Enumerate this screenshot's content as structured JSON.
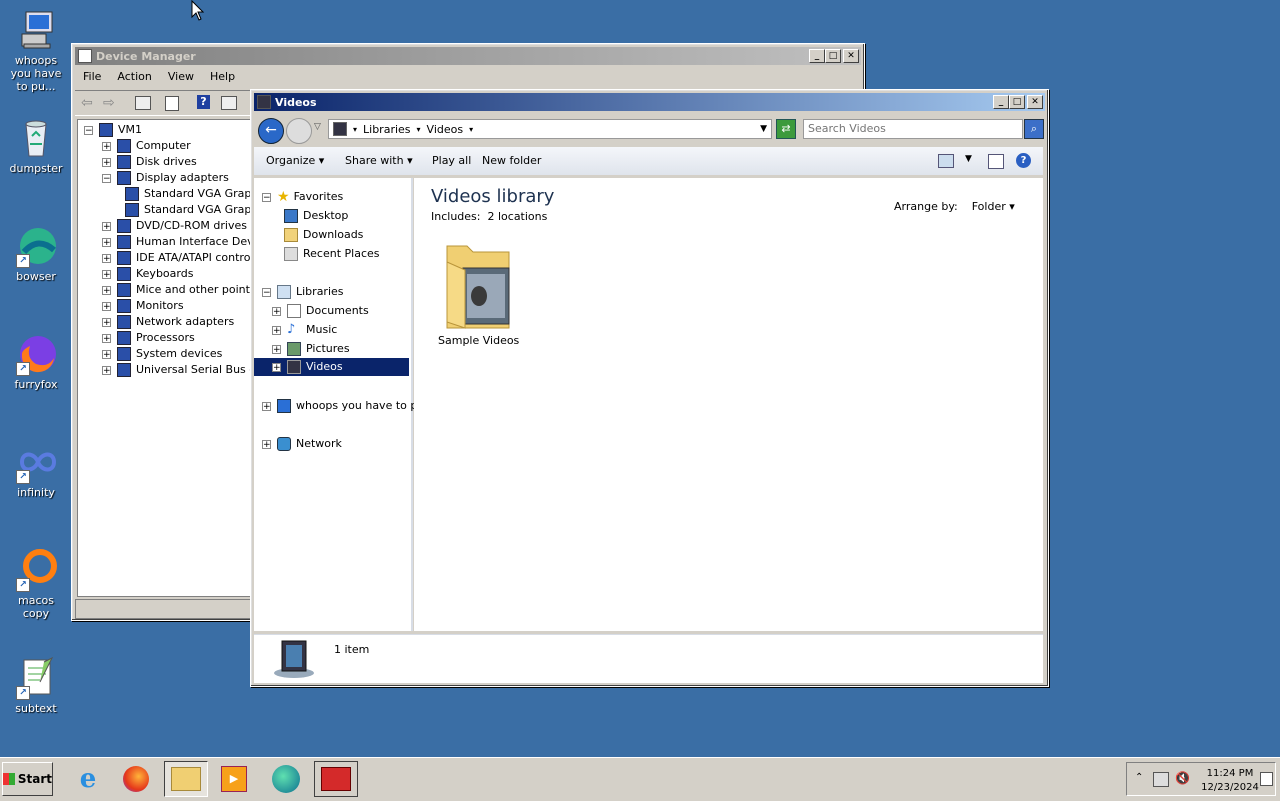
{
  "desktop": {
    "icons": [
      {
        "label": "whoops you have to pu...",
        "icon": "computer-icon"
      },
      {
        "label": "dumpster",
        "icon": "recycle-bin-icon"
      },
      {
        "label": "bowser",
        "icon": "edge-browser-icon"
      },
      {
        "label": "furryfox",
        "icon": "firefox-icon"
      },
      {
        "label": "infinity",
        "icon": "infinity-icon"
      },
      {
        "label": "macos copy",
        "icon": "ring-icon"
      },
      {
        "label": "subtext",
        "icon": "text-editor-icon"
      }
    ]
  },
  "device_manager": {
    "title": "Device Manager",
    "menu": [
      "File",
      "Action",
      "View",
      "Help"
    ],
    "tree": [
      {
        "label": "VM1",
        "level": 0,
        "expander": "-"
      },
      {
        "label": "Computer",
        "level": 1,
        "expander": "+"
      },
      {
        "label": "Disk drives",
        "level": 1,
        "expander": "+"
      },
      {
        "label": "Display adapters",
        "level": 1,
        "expander": "-"
      },
      {
        "label": "Standard VGA Grap",
        "level": 2,
        "expander": ""
      },
      {
        "label": "Standard VGA Grap",
        "level": 2,
        "expander": ""
      },
      {
        "label": "DVD/CD-ROM drives",
        "level": 1,
        "expander": "+"
      },
      {
        "label": "Human Interface Devic",
        "level": 1,
        "expander": "+"
      },
      {
        "label": "IDE ATA/ATAPI controll",
        "level": 1,
        "expander": "+"
      },
      {
        "label": "Keyboards",
        "level": 1,
        "expander": "+"
      },
      {
        "label": "Mice and other pointing",
        "level": 1,
        "expander": "+"
      },
      {
        "label": "Monitors",
        "level": 1,
        "expander": "+"
      },
      {
        "label": "Network adapters",
        "level": 1,
        "expander": "+"
      },
      {
        "label": "Processors",
        "level": 1,
        "expander": "+"
      },
      {
        "label": "System devices",
        "level": 1,
        "expander": "+"
      },
      {
        "label": "Universal Serial Bus cor",
        "level": 1,
        "expander": "+"
      }
    ]
  },
  "explorer": {
    "title": "Videos",
    "breadcrumb": [
      "Libraries",
      "Videos"
    ],
    "search_placeholder": "Search Videos",
    "commands": [
      "Organize",
      "Share with",
      "Play all",
      "New folder"
    ],
    "nav": {
      "favorites": "Favorites",
      "favorites_items": [
        "Desktop",
        "Downloads",
        "Recent Places"
      ],
      "libraries": "Libraries",
      "libraries_items": [
        "Documents",
        "Music",
        "Pictures",
        "Videos"
      ],
      "computer": "whoops you have to put",
      "network": "Network",
      "selected": "Videos"
    },
    "library_title": "Videos library",
    "includes_label": "Includes:",
    "includes_value": "2 locations",
    "arrange_label": "Arrange by:",
    "arrange_value": "Folder",
    "items": [
      {
        "label": "Sample Videos"
      }
    ],
    "status": "1 item"
  },
  "taskbar": {
    "start_label": "Start",
    "apps": [
      "ie-icon",
      "firefox-icon",
      "explorer-icon",
      "media-player-icon",
      "edge-icon",
      "toolbox-icon"
    ],
    "active_app": "explorer-icon",
    "clock_time": "11:24 PM",
    "clock_date": "12/23/2024"
  }
}
